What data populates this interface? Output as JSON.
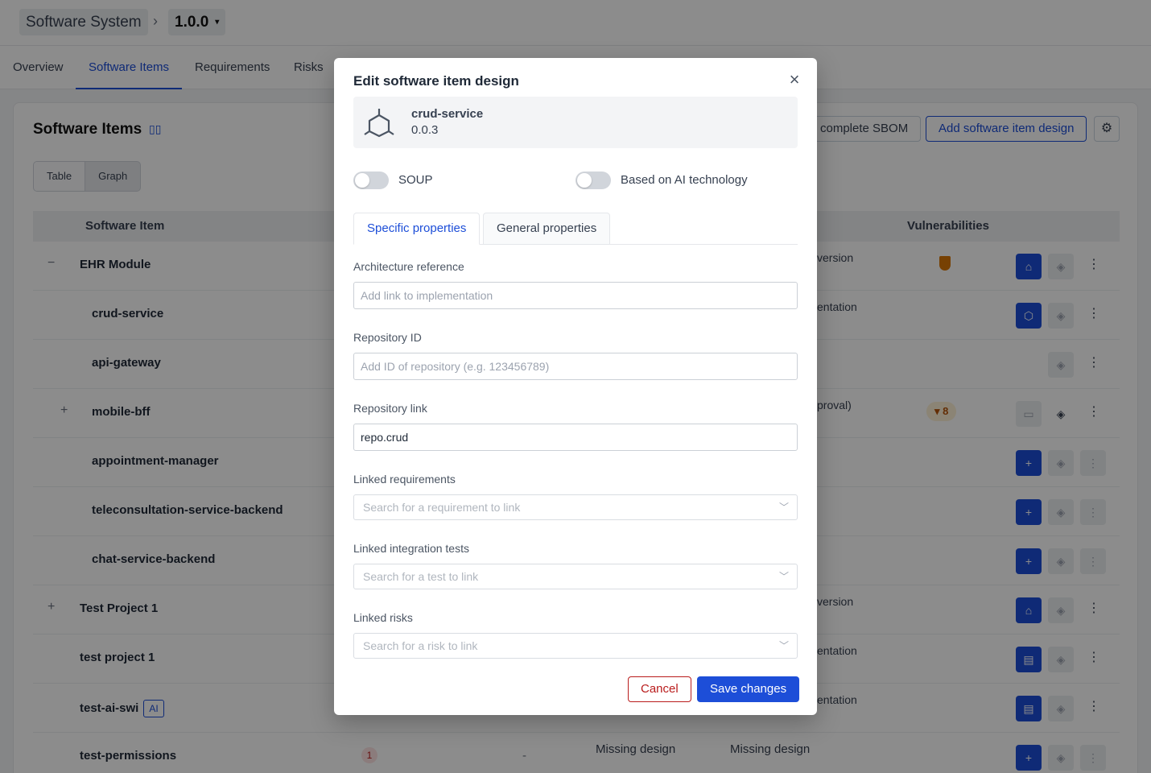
{
  "breadcrumb": {
    "system": "Software System",
    "separator": "›",
    "version": "1.0.0",
    "caret": "▾"
  },
  "nav_tabs": [
    "Overview",
    "Software Items",
    "Requirements",
    "Risks"
  ],
  "page": {
    "title": "Software Items",
    "view_toggle": [
      "Table",
      "Graph"
    ],
    "sbom_label": "complete SBOM",
    "add_label": "Add software item design",
    "columns": {
      "software_item": "Software Item",
      "vulnerabilities": "Vulnerabilities"
    }
  },
  "rows": [
    {
      "name": "EHR Module",
      "expand": "−",
      "side": "version"
    },
    {
      "name": "crud-service",
      "side": "entation"
    },
    {
      "name": "api-gateway",
      "side": ""
    },
    {
      "name": "mobile-bff",
      "expand": "+",
      "side": "proval)",
      "vuln_count": "8"
    },
    {
      "name": "appointment-manager",
      "side": ""
    },
    {
      "name": "teleconsultation-service-backend",
      "side": ""
    },
    {
      "name": "chat-service-backend",
      "side": ""
    },
    {
      "name": "Test Project 1",
      "expand": "+",
      "side": "version"
    },
    {
      "name": "test project 1",
      "side": "entation"
    },
    {
      "name": "test-ai-swi",
      "badge": "AI",
      "side": "entation"
    },
    {
      "name": "test-permissions",
      "count": "1",
      "dash": "-",
      "missing_a": "Missing design",
      "missing_b": "Missing design"
    }
  ],
  "modal": {
    "title": "Edit software item design",
    "item": {
      "name": "crud-service",
      "version": "0.0.3"
    },
    "soup_label": "SOUP",
    "ai_label": "Based on AI technology",
    "tabs": [
      "Specific properties",
      "General properties"
    ],
    "fields": {
      "architecture": {
        "label": "Architecture reference",
        "placeholder": "Add link to implementation"
      },
      "repo_id": {
        "label": "Repository ID",
        "placeholder": "Add ID of repository (e.g. 123456789)"
      },
      "repo_link": {
        "label": "Repository link",
        "value": "repo.crud"
      },
      "requirements": {
        "label": "Linked requirements",
        "placeholder": "Search for a requirement to link"
      },
      "tests": {
        "label": "Linked integration tests",
        "placeholder": "Search for a test to link"
      },
      "risks": {
        "label": "Linked risks",
        "placeholder": "Search for a risk to link"
      }
    },
    "cancel": "Cancel",
    "save": "Save changes"
  },
  "colors": {
    "accent": "#1d4ed8",
    "danger": "#b91c1c",
    "warning": "#d97706"
  }
}
